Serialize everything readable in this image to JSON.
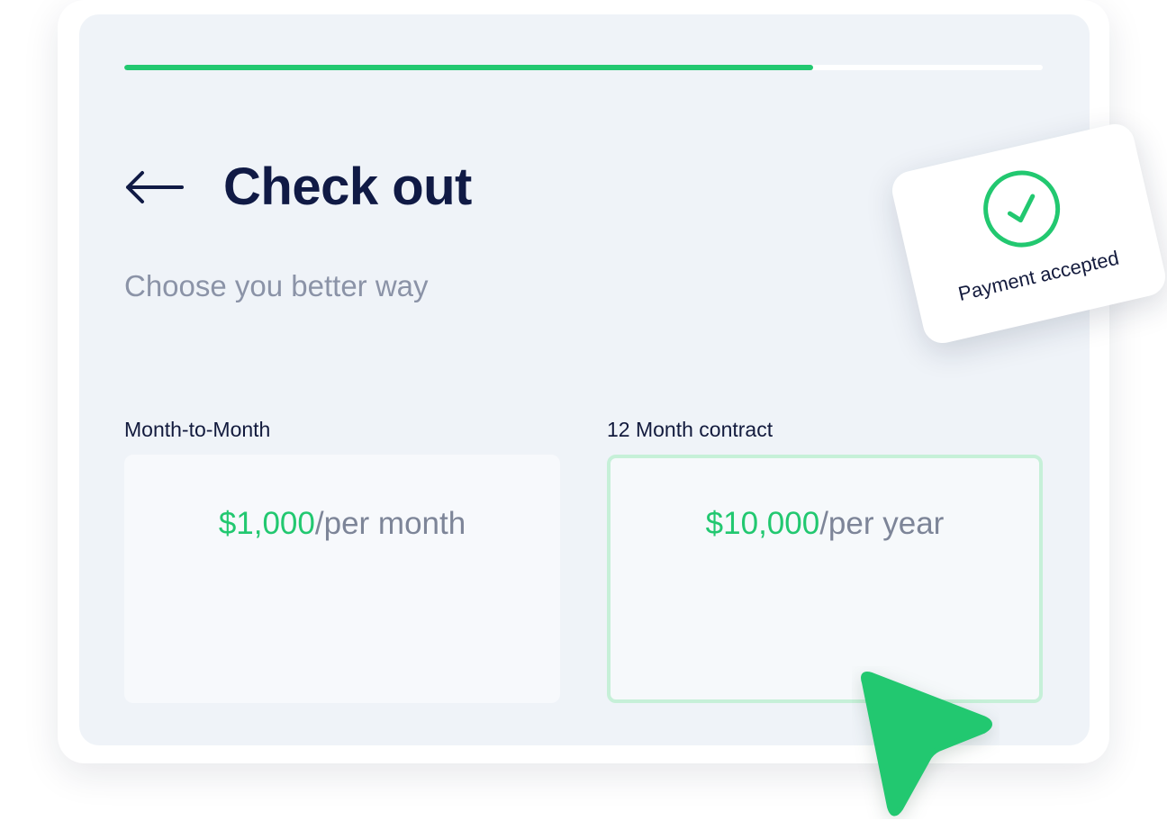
{
  "checkout": {
    "title": "Check out",
    "subtitle": "Choose you better way",
    "progress": 0.75,
    "back_icon": "arrow-left-icon"
  },
  "plans": [
    {
      "label": "Month-to-Month",
      "amount": "$1,000",
      "period": "/per month",
      "selected": false
    },
    {
      "label": "12 Month contract",
      "amount": "$10,000",
      "period": "/per year",
      "selected": true
    }
  ],
  "toast": {
    "text": "Payment accepted",
    "icon": "check-circle-icon"
  },
  "cursor": {
    "icon": "pointer-cursor-icon"
  },
  "colors": {
    "accent": "#22c870",
    "title": "#101a45",
    "muted": "#8b93a7",
    "panel": "#eff3f8",
    "selected_border": "#c6f0d8"
  }
}
